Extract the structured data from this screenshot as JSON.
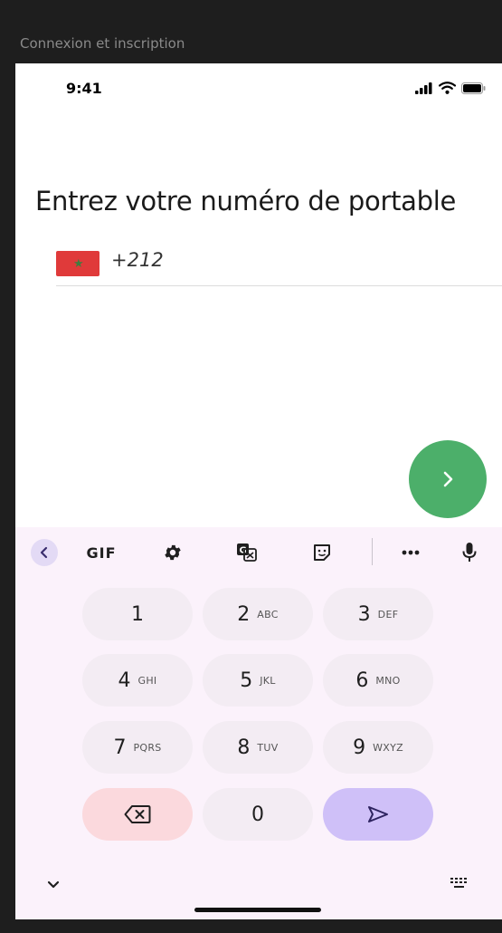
{
  "window": {
    "title": "Connexion et inscription"
  },
  "status_bar": {
    "time": "9:41",
    "icons": [
      "signal-icon",
      "wifi-icon",
      "battery-icon"
    ]
  },
  "screen": {
    "title": "Entrez votre numéro de portable",
    "phone_input": {
      "country_flag": "morocco-flag-icon",
      "dial_code": "+212",
      "value": ""
    },
    "next_button": {
      "icon": "chevron-right-icon",
      "color": "#4caf6a"
    }
  },
  "keyboard": {
    "toolbar": {
      "items": [
        "back-icon",
        "GIF",
        "settings-icon",
        "translate-icon",
        "sticker-icon",
        "more-icon",
        "microphone-icon"
      ],
      "gif_label": "GIF"
    },
    "keys": [
      {
        "num": "1",
        "letters": ""
      },
      {
        "num": "2",
        "letters": "ABC"
      },
      {
        "num": "3",
        "letters": "DEF"
      },
      {
        "num": "4",
        "letters": "GHI"
      },
      {
        "num": "5",
        "letters": "JKL"
      },
      {
        "num": "6",
        "letters": "MNO"
      },
      {
        "num": "7",
        "letters": "PQRS"
      },
      {
        "num": "8",
        "letters": "TUV"
      },
      {
        "num": "9",
        "letters": "WXYZ"
      },
      {
        "num": "0",
        "letters": ""
      }
    ],
    "colors": {
      "background": "#fbf2fb",
      "key": "#f3ecf3",
      "delete": "#fbd9dd",
      "send": "#cfc0f8"
    }
  }
}
